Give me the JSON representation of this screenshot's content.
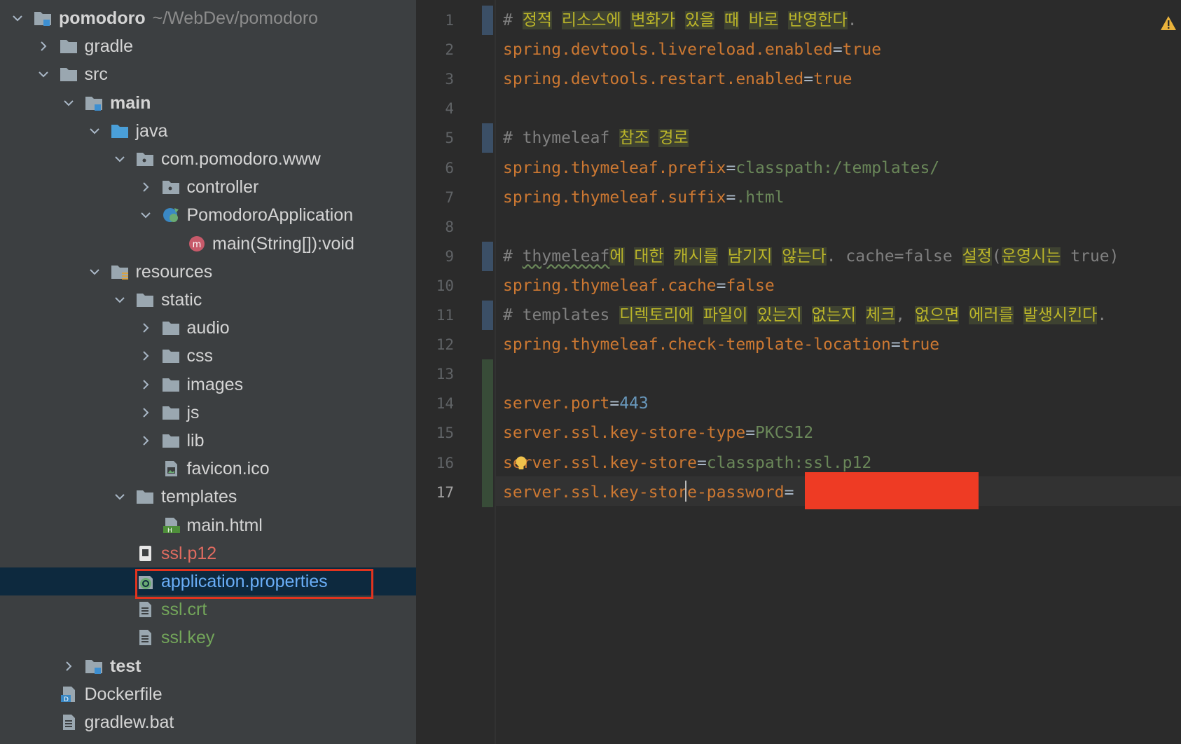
{
  "project": {
    "root": {
      "name": "pomodoro",
      "path": "~/WebDev/pomodoro"
    },
    "items": [
      {
        "name": "gradle",
        "depth": 1,
        "expanded": false,
        "icon": "folder-icon"
      },
      {
        "name": "src",
        "depth": 1,
        "expanded": true,
        "icon": "folder-icon"
      },
      {
        "name": "main",
        "depth": 2,
        "expanded": true,
        "icon": "module-folder-icon",
        "bold": true
      },
      {
        "name": "java",
        "depth": 3,
        "expanded": true,
        "icon": "source-folder-icon"
      },
      {
        "name": "com.pomodoro.www",
        "depth": 4,
        "expanded": true,
        "icon": "package-icon"
      },
      {
        "name": "controller",
        "depth": 5,
        "expanded": false,
        "icon": "package-icon"
      },
      {
        "name": "PomodoroApplication",
        "depth": 5,
        "expanded": true,
        "icon": "spring-class-icon"
      },
      {
        "name": "main(String[]):void",
        "depth": 6,
        "icon": "method-icon"
      },
      {
        "name": "resources",
        "depth": 3,
        "expanded": true,
        "icon": "resources-folder-icon"
      },
      {
        "name": "static",
        "depth": 4,
        "expanded": true,
        "icon": "folder-icon"
      },
      {
        "name": "audio",
        "depth": 5,
        "expanded": false,
        "icon": "folder-icon"
      },
      {
        "name": "css",
        "depth": 5,
        "expanded": false,
        "icon": "folder-icon"
      },
      {
        "name": "images",
        "depth": 5,
        "expanded": false,
        "icon": "folder-icon"
      },
      {
        "name": "js",
        "depth": 5,
        "expanded": false,
        "icon": "folder-icon"
      },
      {
        "name": "lib",
        "depth": 5,
        "expanded": false,
        "icon": "folder-icon"
      },
      {
        "name": "favicon.ico",
        "depth": 5,
        "icon": "image-file-icon"
      },
      {
        "name": "templates",
        "depth": 4,
        "expanded": true,
        "icon": "folder-icon"
      },
      {
        "name": "main.html",
        "depth": 5,
        "icon": "html-file-icon"
      },
      {
        "name": "ssl.p12",
        "depth": 4,
        "icon": "certificate-file-icon",
        "color": "red"
      },
      {
        "name": "application.properties",
        "depth": 4,
        "icon": "spring-properties-icon",
        "color": "blue",
        "selected": true
      },
      {
        "name": "ssl.crt",
        "depth": 4,
        "icon": "text-file-icon",
        "color": "green"
      },
      {
        "name": "ssl.key",
        "depth": 4,
        "icon": "text-file-icon",
        "color": "green"
      },
      {
        "name": "test",
        "depth": 2,
        "expanded": false,
        "icon": "module-folder-icon",
        "bold": true
      },
      {
        "name": "Dockerfile",
        "depth": 1,
        "icon": "docker-file-icon"
      },
      {
        "name": "gradlew.bat",
        "depth": 1,
        "icon": "text-file-icon"
      }
    ]
  },
  "editor": {
    "current_line": 17,
    "lines": [
      [
        {
          "t": "# ",
          "s": "c"
        },
        {
          "t": "정적",
          "s": "hl"
        },
        {
          "t": " ",
          "s": "c"
        },
        {
          "t": "리소스에",
          "s": "hl"
        },
        {
          "t": " ",
          "s": "c"
        },
        {
          "t": "변화가",
          "s": "hl"
        },
        {
          "t": " ",
          "s": "c"
        },
        {
          "t": "있을",
          "s": "hl"
        },
        {
          "t": " ",
          "s": "c"
        },
        {
          "t": "때",
          "s": "hl"
        },
        {
          "t": " ",
          "s": "c"
        },
        {
          "t": "바로",
          "s": "hl"
        },
        {
          "t": " ",
          "s": "c"
        },
        {
          "t": "반영한다",
          "s": "hl"
        },
        {
          "t": ".",
          "s": "c"
        }
      ],
      [
        {
          "t": "spring.devtools.livereload.enabled",
          "s": "k"
        },
        {
          "t": "=",
          "s": "p"
        },
        {
          "t": "true",
          "s": "k"
        }
      ],
      [
        {
          "t": "spring.devtools.restart.enabled",
          "s": "k"
        },
        {
          "t": "=",
          "s": "p"
        },
        {
          "t": "true",
          "s": "k"
        }
      ],
      [],
      [
        {
          "t": "# thymeleaf ",
          "s": "c"
        },
        {
          "t": "참조",
          "s": "hl"
        },
        {
          "t": " ",
          "s": "c"
        },
        {
          "t": "경로",
          "s": "hl"
        }
      ],
      [
        {
          "t": "spring.thymeleaf.prefix",
          "s": "k"
        },
        {
          "t": "=",
          "s": "p"
        },
        {
          "t": "classpath:/templates/",
          "s": "v"
        }
      ],
      [
        {
          "t": "spring.thymeleaf.suffix",
          "s": "k"
        },
        {
          "t": "=",
          "s": "p"
        },
        {
          "t": ".html",
          "s": "v"
        }
      ],
      [],
      [
        {
          "t": "# ",
          "s": "c"
        },
        {
          "t": "thymeleaf",
          "s": "cw"
        },
        {
          "t": "에",
          "s": "hl"
        },
        {
          "t": " ",
          "s": "c"
        },
        {
          "t": "대한",
          "s": "hl"
        },
        {
          "t": " ",
          "s": "c"
        },
        {
          "t": "캐시를",
          "s": "hl"
        },
        {
          "t": " ",
          "s": "c"
        },
        {
          "t": "남기지",
          "s": "hl"
        },
        {
          "t": " ",
          "s": "c"
        },
        {
          "t": "않는다",
          "s": "hl"
        },
        {
          "t": ". cache=false ",
          "s": "c"
        },
        {
          "t": "설정",
          "s": "hl"
        },
        {
          "t": "(",
          "s": "c"
        },
        {
          "t": "운영시는",
          "s": "hl"
        },
        {
          "t": " true)",
          "s": "c"
        }
      ],
      [
        {
          "t": "spring.thymeleaf.cache",
          "s": "k"
        },
        {
          "t": "=",
          "s": "p"
        },
        {
          "t": "false",
          "s": "k"
        }
      ],
      [
        {
          "t": "# templates ",
          "s": "c"
        },
        {
          "t": "디렉토리에",
          "s": "hl"
        },
        {
          "t": " ",
          "s": "c"
        },
        {
          "t": "파일이",
          "s": "hl"
        },
        {
          "t": " ",
          "s": "c"
        },
        {
          "t": "있는지",
          "s": "hl"
        },
        {
          "t": " ",
          "s": "c"
        },
        {
          "t": "없는지",
          "s": "hl"
        },
        {
          "t": " ",
          "s": "c"
        },
        {
          "t": "체크",
          "s": "hl"
        },
        {
          "t": ", ",
          "s": "c"
        },
        {
          "t": "없으면",
          "s": "hl"
        },
        {
          "t": " ",
          "s": "c"
        },
        {
          "t": "에러를",
          "s": "hl"
        },
        {
          "t": " ",
          "s": "c"
        },
        {
          "t": "발생시킨다",
          "s": "hl"
        },
        {
          "t": ".",
          "s": "c"
        }
      ],
      [
        {
          "t": "spring.thymeleaf.check-template-location",
          "s": "k"
        },
        {
          "t": "=",
          "s": "p"
        },
        {
          "t": "true",
          "s": "k"
        }
      ],
      [],
      [
        {
          "t": "server.port",
          "s": "k"
        },
        {
          "t": "=",
          "s": "p"
        },
        {
          "t": "443",
          "s": "n"
        }
      ],
      [
        {
          "t": "server.ssl.key-store-type",
          "s": "k"
        },
        {
          "t": "=",
          "s": "p"
        },
        {
          "t": "PKCS12",
          "s": "v"
        }
      ],
      [
        {
          "t": "server.ssl.key-store",
          "s": "k"
        },
        {
          "t": "=",
          "s": "p"
        },
        {
          "t": "classpath:ssl.p12",
          "s": "v"
        }
      ],
      [
        {
          "t": "server.ssl.key-store-password",
          "s": "k"
        },
        {
          "t": "=",
          "s": "p"
        }
      ]
    ],
    "change_markers": [
      {
        "lines": [
          1,
          1
        ],
        "kind": "modified"
      },
      {
        "lines": [
          5,
          5
        ],
        "kind": "modified"
      },
      {
        "lines": [
          9,
          9
        ],
        "kind": "modified"
      },
      {
        "lines": [
          11,
          11
        ],
        "kind": "modified"
      },
      {
        "lines": [
          13,
          17
        ],
        "kind": "added"
      }
    ]
  },
  "colors": {
    "keyword": "#cc7832",
    "value": "#6a8759",
    "number": "#6897bb",
    "comment": "#808080",
    "selection": "#0d293e",
    "annotation_box": "#e0341f",
    "redaction": "#ee3b24"
  },
  "icons": [
    "chevron-down-icon",
    "chevron-right-icon",
    "folder-icon",
    "warning-icon",
    "lightbulb-icon"
  ]
}
